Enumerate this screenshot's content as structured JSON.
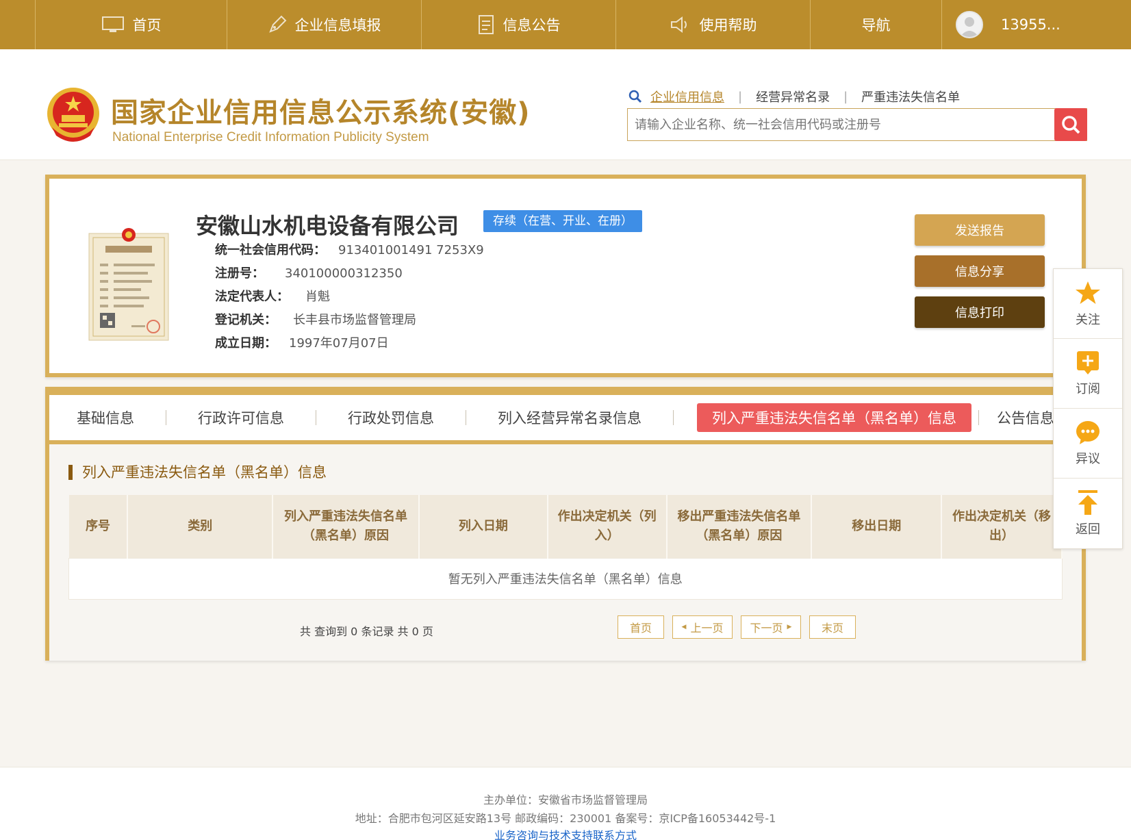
{
  "nav": {
    "items": [
      {
        "label": "首页",
        "icon": "monitor-icon"
      },
      {
        "label": "企业信息填报",
        "icon": "pen-icon"
      },
      {
        "label": "信息公告",
        "icon": "document-icon"
      },
      {
        "label": "使用帮助",
        "icon": "speaker-icon"
      },
      {
        "label": "导航",
        "icon": ""
      }
    ],
    "user": "13955..."
  },
  "header": {
    "title": "国家企业信用信息公示系统(安徽)",
    "subtitle": "National Enterprise Credit Information Publicity System",
    "search_tabs": [
      "企业信用信息",
      "经营异常名录",
      "严重违法失信名单"
    ],
    "search_placeholder": "请输入企业名称、统一社会信用代码或注册号"
  },
  "company": {
    "name": "安徽山水机电设备有限公司",
    "status": "存续（在营、开业、在册）",
    "fields": [
      {
        "label": "统一社会信用代码：",
        "value": "913401001491 7253X9"
      },
      {
        "label": "注册号：",
        "value": "340100000312350"
      },
      {
        "label": "法定代表人：",
        "value": "肖魁"
      },
      {
        "label": "登记机关：",
        "value": "长丰县市场监督管理局"
      },
      {
        "label": "成立日期：",
        "value": "1997年07月07日"
      }
    ],
    "actions": [
      "发送报告",
      "信息分享",
      "信息打印"
    ]
  },
  "tabs": {
    "items": [
      "基础信息",
      "行政许可信息",
      "行政处罚信息",
      "列入经营异常名录信息",
      "列入严重违法失信名单（黑名单）信息",
      "公告信息"
    ],
    "active_index": 4
  },
  "section": {
    "title": "列入严重违法失信名单（黑名单）信息",
    "columns": [
      "序号",
      "类别",
      "列入严重违法失信名单（黑名单）原因",
      "列入日期",
      "作出决定机关（列入）",
      "移出严重违法失信名单（黑名单）原因",
      "移出日期",
      "作出决定机关（移出）"
    ],
    "empty_text": "暂无列入严重违法失信名单（黑名单）信息"
  },
  "pager": {
    "info": "共 查询到 0 条记录 共 0 页",
    "first": "首页",
    "prev": "上一页",
    "next": "下一页",
    "last": "末页"
  },
  "side": {
    "items": [
      {
        "label": "关注",
        "icon": "star-icon"
      },
      {
        "label": "订阅",
        "icon": "plus-square-icon"
      },
      {
        "label": "异议",
        "icon": "chat-bubble-icon"
      },
      {
        "label": "返回",
        "icon": "arrow-up-icon"
      }
    ]
  },
  "footer": {
    "sponsor": "主办单位：安徽省市场监督管理局",
    "address": "地址：合肥市包河区延安路13号  邮政编码：230001  备案号：京ICP备16053442号-1",
    "contact": "业务咨询与技术支持联系方式"
  },
  "colors": {
    "gold": "#bb8d2c",
    "border_gold": "#d9b05a",
    "status_blue": "#3e8ee6",
    "active_tab_red": "#ec5b5b",
    "search_red": "#e84a4a",
    "btn_send": "#d4a552",
    "btn_share": "#a8702a",
    "btn_print": "#5e4010"
  }
}
